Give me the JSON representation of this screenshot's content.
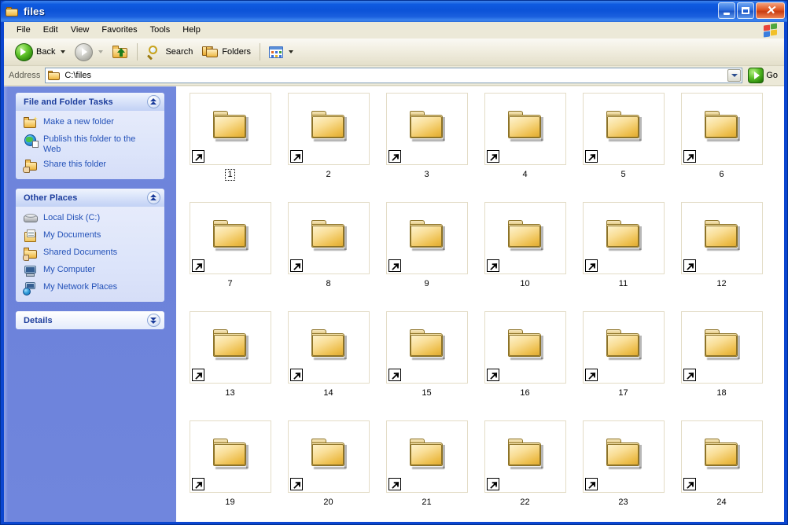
{
  "window": {
    "title": "files",
    "icon": "folder-open-icon",
    "buttons": {
      "minimize": "Minimize",
      "maximize": "Maximize",
      "close": "Close",
      "close_glyph": "✕"
    }
  },
  "menubar": {
    "items": [
      {
        "label": "File"
      },
      {
        "label": "Edit"
      },
      {
        "label": "View"
      },
      {
        "label": "Favorites"
      },
      {
        "label": "Tools"
      },
      {
        "label": "Help"
      }
    ],
    "brand_icon": "windows-flag-icon"
  },
  "toolbar": {
    "back_label": "Back",
    "forward_label": "",
    "up_label": "",
    "search_label": "Search",
    "folders_label": "Folders",
    "views_label": ""
  },
  "addressbar": {
    "label": "Address",
    "value": "C:\\files",
    "placeholder": "C:\\files",
    "go_label": "Go"
  },
  "sidebar": {
    "panels": [
      {
        "title": "File and Folder Tasks",
        "collapse_state": "expanded",
        "items": [
          {
            "label": "Make a new folder",
            "icon": "new-folder-icon"
          },
          {
            "label": "Publish this folder to the Web",
            "icon": "publish-web-icon"
          },
          {
            "label": "Share this folder",
            "icon": "share-folder-icon"
          }
        ]
      },
      {
        "title": "Other Places",
        "collapse_state": "expanded",
        "items": [
          {
            "label": "Local Disk (C:)",
            "icon": "hard-disk-icon"
          },
          {
            "label": "My Documents",
            "icon": "my-documents-icon"
          },
          {
            "label": "Shared Documents",
            "icon": "shared-documents-icon"
          },
          {
            "label": "My Computer",
            "icon": "my-computer-icon"
          },
          {
            "label": "My Network Places",
            "icon": "network-places-icon"
          }
        ]
      },
      {
        "title": "Details",
        "collapse_state": "collapsed",
        "items": []
      }
    ]
  },
  "content": {
    "view_mode": "thumbnails",
    "selected_item": "1",
    "items": [
      {
        "label": "1",
        "type": "folder-shortcut"
      },
      {
        "label": "2",
        "type": "folder-shortcut"
      },
      {
        "label": "3",
        "type": "folder-shortcut"
      },
      {
        "label": "4",
        "type": "folder-shortcut"
      },
      {
        "label": "5",
        "type": "folder-shortcut"
      },
      {
        "label": "6",
        "type": "folder-shortcut"
      },
      {
        "label": "7",
        "type": "folder-shortcut"
      },
      {
        "label": "8",
        "type": "folder-shortcut"
      },
      {
        "label": "9",
        "type": "folder-shortcut"
      },
      {
        "label": "10",
        "type": "folder-shortcut"
      },
      {
        "label": "11",
        "type": "folder-shortcut"
      },
      {
        "label": "12",
        "type": "folder-shortcut"
      },
      {
        "label": "13",
        "type": "folder-shortcut"
      },
      {
        "label": "14",
        "type": "folder-shortcut"
      },
      {
        "label": "15",
        "type": "folder-shortcut"
      },
      {
        "label": "16",
        "type": "folder-shortcut"
      },
      {
        "label": "17",
        "type": "folder-shortcut"
      },
      {
        "label": "18",
        "type": "folder-shortcut"
      },
      {
        "label": "19",
        "type": "folder-shortcut"
      },
      {
        "label": "20",
        "type": "folder-shortcut"
      },
      {
        "label": "21",
        "type": "folder-shortcut"
      },
      {
        "label": "22",
        "type": "folder-shortcut"
      },
      {
        "label": "23",
        "type": "folder-shortcut"
      },
      {
        "label": "24",
        "type": "folder-shortcut"
      }
    ]
  },
  "colors": {
    "titlebar_blue": "#0b46d0",
    "sidebar_blue": "#6f86dc",
    "panel_header": "#c3d2f5",
    "link_blue": "#2351b8",
    "header_text": "#1c3d9c",
    "folder_yellow": "#edbe4c",
    "close_red": "#e35a26",
    "go_green": "#2d880b",
    "tile_border": "#e3dcc6"
  }
}
